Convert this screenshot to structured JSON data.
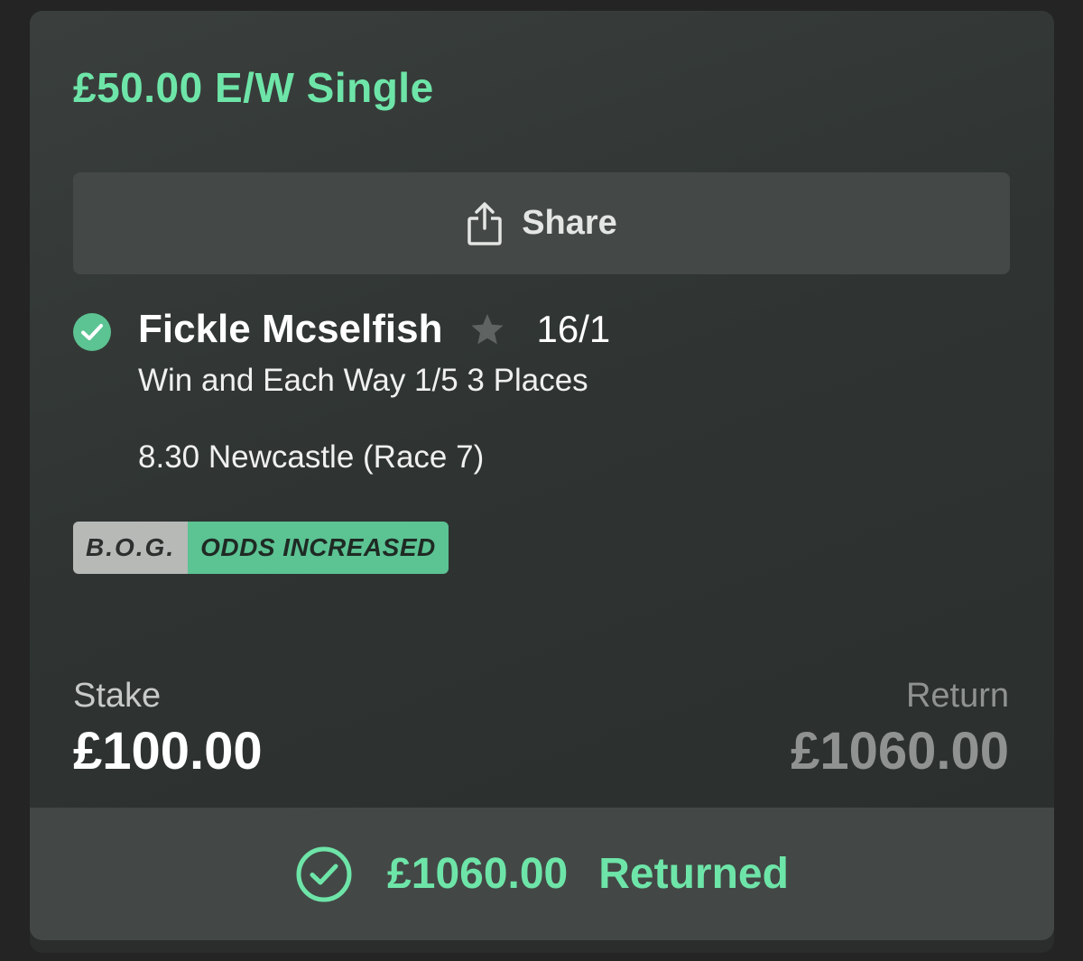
{
  "bet": {
    "title": "£50.00 E/W Single"
  },
  "share": {
    "label": "Share",
    "icon": "share-icon"
  },
  "selection": {
    "status_icon": "check-circle-icon",
    "name": "Fickle Mcselfish",
    "favourite_icon": "star-icon",
    "odds": "16/1",
    "market": "Win and Each Way 1/5 3 Places",
    "event": "8.30 Newcastle (Race 7)"
  },
  "badges": {
    "bog": "B.O.G.",
    "odds_increased": "ODDS INCREASED"
  },
  "stake": {
    "label": "Stake",
    "value": "£100.00"
  },
  "return": {
    "label": "Return",
    "value": "£1060.00"
  },
  "footer": {
    "icon": "check-circle-icon",
    "amount": "£1060.00",
    "status": "Returned"
  },
  "colors": {
    "accent": "#6ee5a8",
    "badge_green": "#5cc393",
    "badge_grey": "#b7b9b7",
    "card_bg": "#323735",
    "page_bg": "#232423"
  }
}
